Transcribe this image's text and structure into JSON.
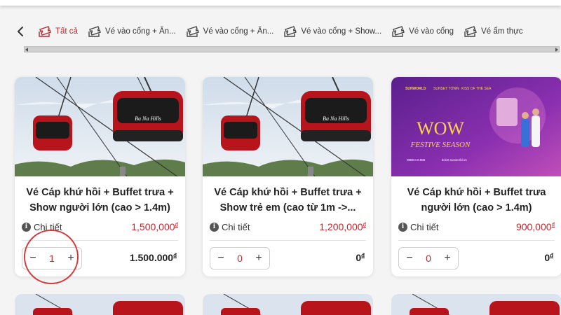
{
  "tabs": [
    {
      "label": "Tất cả",
      "active": true
    },
    {
      "label": "Vé vào cổng + Ăn...",
      "active": false
    },
    {
      "label": "Vé vào cổng + Ăn...",
      "active": false
    },
    {
      "label": "Vé vào cổng + Show...",
      "active": false
    },
    {
      "label": "Vé vào cổng",
      "active": false
    },
    {
      "label": "Vé ẩm thực",
      "active": false
    }
  ],
  "cards": [
    {
      "title": "Vé Cáp khứ hồi + Buffet trưa + Show người lớn (cao > 1.4m)",
      "detail_label": "Chi tiết",
      "price": "1,500,000",
      "currency": "đ",
      "qty": "1",
      "total": "1.500.000",
      "total_currency": "đ",
      "image": "cable-car"
    },
    {
      "title": "Vé Cáp khứ hồi + Buffet trưa + Show trẻ em (cao từ 1m ->...",
      "detail_label": "Chi tiết",
      "price": "1,200,000",
      "currency": "đ",
      "qty": "0",
      "total": "0",
      "total_currency": "đ",
      "image": "cable-car"
    },
    {
      "title": "Vé Cáp khứ hồi + Buffet trưa người lớn (cao > 1.4m)",
      "detail_label": "Chi tiết",
      "price": "900,000",
      "currency": "đ",
      "qty": "0",
      "total": "0",
      "total_currency": "đ",
      "image": "festive-banner",
      "banner": {
        "headline": "WOW",
        "subline": "FESTIVE SEASON",
        "brand1": "SUNWORLD",
        "brand2": "SUNSET TOWN",
        "brand3": "KISS OF THE SEA",
        "hotline": "0888.0.0.888",
        "site": "ticket.sunworld.vn"
      }
    }
  ],
  "gondola_brand": "Ba Na Hills",
  "colors": {
    "accent": "#c0262d",
    "highlight_circle": "#d43a3a",
    "banner_purple": "#7a2fa8"
  }
}
